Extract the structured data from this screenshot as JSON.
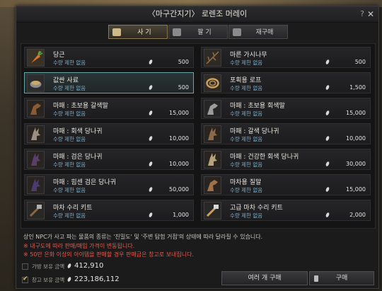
{
  "window": {
    "title": "〈마구간지기〉 로렌조 머레이",
    "help": "?",
    "close": "✕"
  },
  "tabs": [
    {
      "label": "사 기",
      "active": true
    },
    {
      "label": "팔 기",
      "active": false
    },
    {
      "label": "재구매",
      "active": false
    }
  ],
  "items": [
    {
      "name": "당근",
      "limit": "수량 제한 없음",
      "price": "500",
      "icon": "carrot-icon",
      "selected": false
    },
    {
      "name": "마른 가시나무",
      "limit": "수량 제한 없음",
      "price": "500",
      "icon": "thorn-branch-icon",
      "selected": false
    },
    {
      "name": "값싼 사료",
      "limit": "수량 제한 없음",
      "price": "500",
      "icon": "feed-bowl-icon",
      "selected": true
    },
    {
      "name": "포획용 로프",
      "limit": "수량 제한 없음",
      "price": "1,500",
      "icon": "rope-icon",
      "selected": false
    },
    {
      "name": "마패 : 초보용 갈색말",
      "limit": "수량 제한 없음",
      "price": "15,000",
      "icon": "brown-horse-icon",
      "selected": false
    },
    {
      "name": "마패 : 초보용 회색말",
      "limit": "수량 제한 없음",
      "price": "15,000",
      "icon": "gray-horse-icon",
      "selected": false
    },
    {
      "name": "마패 : 회색 당나귀",
      "limit": "수량 제한 없음",
      "price": "10,000",
      "icon": "gray-donkey-icon",
      "selected": false
    },
    {
      "name": "마패 : 갈색 당나귀",
      "limit": "수량 제한 없음",
      "price": "10,000",
      "icon": "brown-donkey-icon",
      "selected": false
    },
    {
      "name": "마패 : 검은 당나귀",
      "limit": "수량 제한 없음",
      "price": "10,000",
      "icon": "black-donkey-icon",
      "selected": false
    },
    {
      "name": "마패 : 건강한 회색 당나귀",
      "limit": "수량 제한 없음",
      "price": "30,000",
      "icon": "healthy-gray-donkey-icon",
      "selected": false
    },
    {
      "name": "마패 : 힘센 검은 당나귀",
      "limit": "수량 제한 없음",
      "price": "50,000",
      "icon": "strong-black-donkey-icon",
      "selected": false
    },
    {
      "name": "마차용 질말",
      "limit": "수량 제한 없음",
      "price": "15,000",
      "icon": "wagon-horse-icon",
      "selected": false
    },
    {
      "name": "마차 수리 키트",
      "limit": "수량 제한 없음",
      "price": "1,000",
      "icon": "repair-kit-icon",
      "selected": false
    },
    {
      "name": "고급 마차 수리 키트",
      "limit": "수량 제한 없음",
      "price": "2,000",
      "icon": "premium-repair-kit-icon",
      "selected": false
    }
  ],
  "info": {
    "line1": "상인 NPC가 사고 파는 물품의 종류는 '친밀도' 및 '주변 탐험 거점'의 상태에 따라 달라질 수 있습니다.",
    "line2": "※ 내구도에 따라 판매/매입 가격이 변동됩니다.",
    "line3": "※ 50만 은화 이상의 아이템을 판매할 경우 판매금은 창고로 보내집니다."
  },
  "balances": {
    "bag_label": "가방 보유 금액",
    "bag_amount": "412,910",
    "bag_checked": false,
    "warehouse_label": "창고 보유 금액",
    "warehouse_amount": "223,186,112",
    "warehouse_checked": true
  },
  "buttons": {
    "multi_buy": "여러 개 구매",
    "buy": "구매"
  },
  "colors": {
    "limit_text": "#6fb1d6",
    "warning_text": "#e25b4f",
    "selected_border": "#6aa5a8"
  }
}
